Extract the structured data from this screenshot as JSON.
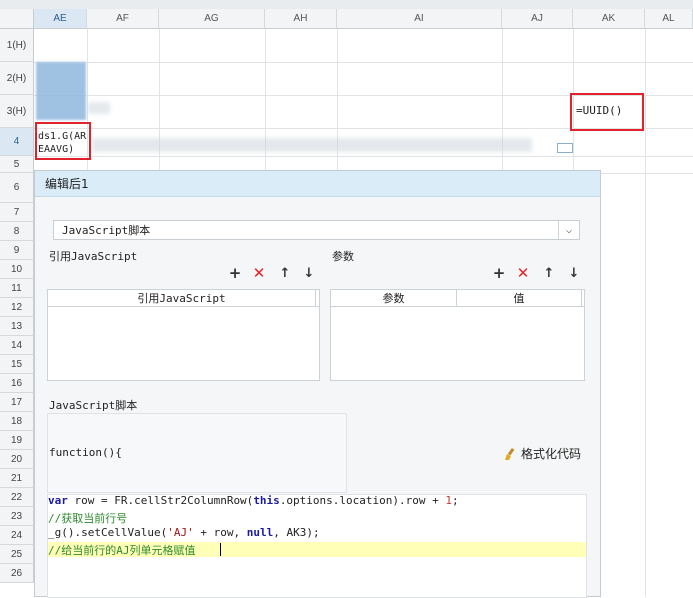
{
  "columns": [
    "AE",
    "AF",
    "AG",
    "AH",
    "AI",
    "AJ",
    "AK",
    "AL"
  ],
  "rows": [
    "1(H)",
    "2(H)",
    "3(H)",
    "4",
    "5",
    "6",
    "7",
    "8",
    "9",
    "10",
    "11",
    "12",
    "13",
    "14",
    "15",
    "16",
    "17",
    "18",
    "19",
    "20",
    "21",
    "22",
    "23",
    "24",
    "25",
    "26"
  ],
  "cells": {
    "ae4": "ds1.G(AR\nEAAVG)",
    "ak3": "=UUID()"
  },
  "dialog": {
    "title": "编辑后1",
    "type_select": "JavaScript脚本",
    "ref_js_label": "引用JavaScript",
    "params_label": "参数",
    "ref_table_header": "引用JavaScript",
    "param_col_name": "参数",
    "param_col_value": "值",
    "script_label": "JavaScript脚本",
    "function_header": "function(){",
    "format_button": "格式化代码",
    "code": {
      "line1_kw_var": "var",
      "line1_a": " row = FR.cellStr2ColumnRow(",
      "line1_kw_this": "this",
      "line1_b": ".options.location).row + ",
      "line1_num": "1",
      "line1_c": ";",
      "line2": "//获取当前行号",
      "line3_a": "_g().setCellValue(",
      "line3_str": "'AJ'",
      "line3_b": " + row, ",
      "line3_kw": "null",
      "line3_c": ", AK3);",
      "line4": "//给当前行的AJ列单元格赋值"
    }
  },
  "colors": {
    "accent_red": "#e0232a",
    "selection_blue": "#dbe8f4",
    "dialog_title_bg": "#d9ecf8",
    "highlight_line": "#ffffb8"
  },
  "icons": [
    "plus-icon",
    "delete-x-icon",
    "arrow-up-icon",
    "arrow-down-icon",
    "brush-icon",
    "chevron-down-icon"
  ]
}
